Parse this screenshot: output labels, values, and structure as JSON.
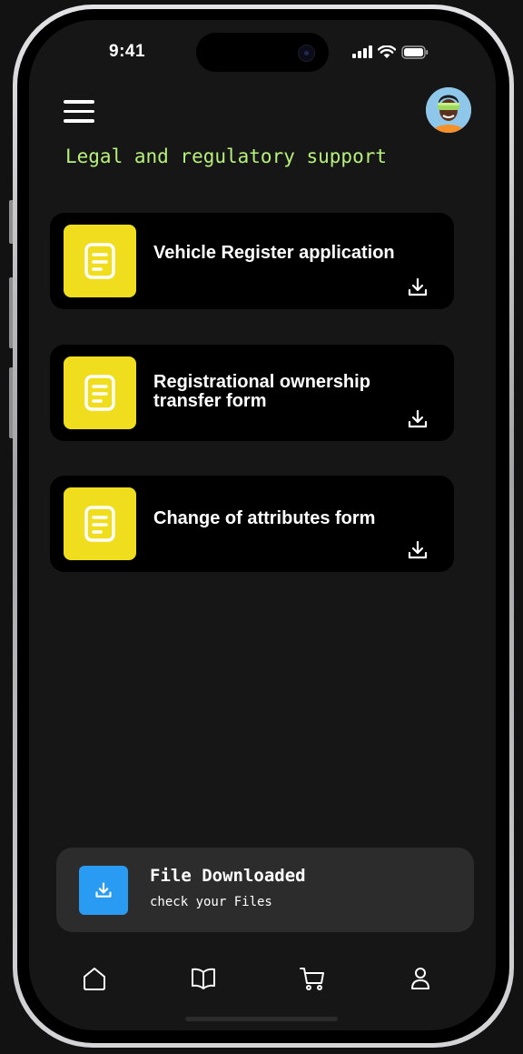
{
  "status_bar": {
    "time": "9:41"
  },
  "header": {
    "title": "Legal and regulatory support"
  },
  "documents": [
    {
      "title": "Vehicle Register application"
    },
    {
      "title": "Registrational ownership transfer form"
    },
    {
      "title": "Change of attributes form"
    }
  ],
  "toast": {
    "title": "File Downloaded",
    "subtitle": "check your Files"
  },
  "bottom_nav": [
    "home-icon",
    "book-icon",
    "cart-icon",
    "profile-icon"
  ],
  "colors": {
    "accent_title": "#b7f07b",
    "doc_tile": "#f0dd1d",
    "toast_icon": "#2a9bf3",
    "background": "#161616"
  }
}
